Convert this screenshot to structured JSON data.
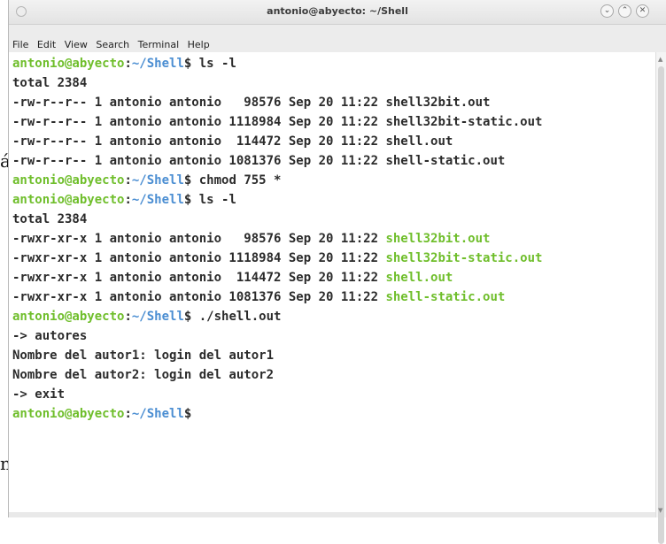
{
  "background": {
    "char1": "á",
    "char2": "n"
  },
  "window": {
    "title": "antonio@abyecto: ~/Shell",
    "controls": {
      "minimize": "⌄",
      "maximize": "⌃",
      "close": "✕"
    }
  },
  "menu": {
    "items": [
      "File",
      "Edit",
      "View",
      "Search",
      "Terminal",
      "Help"
    ]
  },
  "terminal": {
    "lines": [
      {
        "user": "antonio@abyecto",
        "sep": ":",
        "path": "~/Shell",
        "cmd": "$ ls -l"
      },
      {
        "text": "total 2384"
      },
      {
        "text": "-rw-r--r-- 1 antonio antonio   98576 Sep 20 11:22 ",
        "file": "shell32bit.out"
      },
      {
        "text": "-rw-r--r-- 1 antonio antonio 1118984 Sep 20 11:22 ",
        "file": "shell32bit-static.out"
      },
      {
        "text": "-rw-r--r-- 1 antonio antonio  114472 Sep 20 11:22 ",
        "file": "shell.out"
      },
      {
        "text": "-rw-r--r-- 1 antonio antonio 1081376 Sep 20 11:22 ",
        "file": "shell-static.out"
      },
      {
        "user": "antonio@abyecto",
        "sep": ":",
        "path": "~/Shell",
        "cmd": "$ chmod 755 *"
      },
      {
        "user": "antonio@abyecto",
        "sep": ":",
        "path": "~/Shell",
        "cmd": "$ ls -l"
      },
      {
        "text": "total 2384"
      },
      {
        "text": "-rwxr-xr-x 1 antonio antonio   98576 Sep 20 11:22 ",
        "exec": "shell32bit.out"
      },
      {
        "text": "-rwxr-xr-x 1 antonio antonio 1118984 Sep 20 11:22 ",
        "exec": "shell32bit-static.out"
      },
      {
        "text": "-rwxr-xr-x 1 antonio antonio  114472 Sep 20 11:22 ",
        "exec": "shell.out"
      },
      {
        "text": "-rwxr-xr-x 1 antonio antonio 1081376 Sep 20 11:22 ",
        "exec": "shell-static.out"
      },
      {
        "user": "antonio@abyecto",
        "sep": ":",
        "path": "~/Shell",
        "cmd": "$ ./shell.out"
      },
      {
        "text": "-> autores"
      },
      {
        "text": "Nombre del autor1: login del autor1"
      },
      {
        "text": "Nombre del autor2: login del autor2"
      },
      {
        "text": "-> exit"
      },
      {
        "user": "antonio@abyecto",
        "sep": ":",
        "path": "~/Shell",
        "cmd": "$"
      }
    ]
  },
  "colors": {
    "prompt_user": "#6fbe2b",
    "prompt_path": "#4b8ed2",
    "executable": "#6fbe2b",
    "text": "#2b2b2b"
  }
}
